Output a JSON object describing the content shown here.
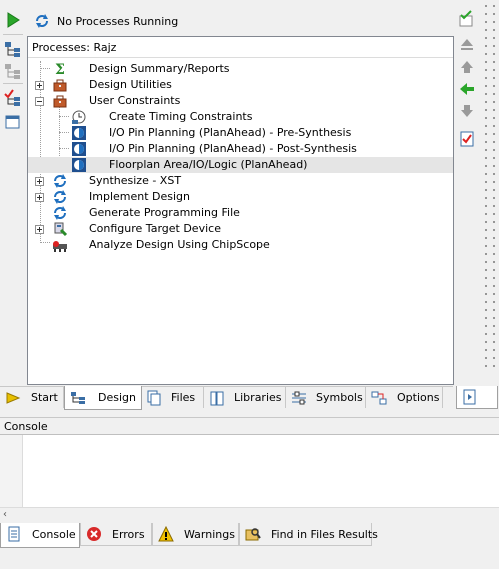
{
  "status": {
    "text": "No Processes Running"
  },
  "processes": {
    "title": "Processes:",
    "project": "Rajz",
    "items": [
      {
        "label": "Design Summary/Reports",
        "icon": "sigma-icon"
      },
      {
        "label": "Design Utilities",
        "icon": "toolbox-icon"
      },
      {
        "label": "User Constraints",
        "icon": "toolbox-icon"
      },
      {
        "label": "Create Timing Constraints",
        "icon": "clock-icon"
      },
      {
        "label": "I/O Pin Planning (PlanAhead) - Pre-Synthesis",
        "icon": "planahead-icon"
      },
      {
        "label": "I/O Pin Planning (PlanAhead) - Post-Synthesis",
        "icon": "planahead-icon"
      },
      {
        "label": "Floorplan Area/IO/Logic (PlanAhead)",
        "icon": "planahead-icon"
      },
      {
        "label": "Synthesize - XST",
        "icon": "process-cycle-icon"
      },
      {
        "label": "Implement Design",
        "icon": "process-cycle-icon"
      },
      {
        "label": "Generate Programming File",
        "icon": "process-cycle-icon"
      },
      {
        "label": "Configure Target Device",
        "icon": "device-icon"
      },
      {
        "label": "Analyze Design Using ChipScope",
        "icon": "chipscope-icon"
      }
    ]
  },
  "tabs": [
    {
      "label": "Start"
    },
    {
      "label": "Design"
    },
    {
      "label": "Files"
    },
    {
      "label": "Libraries"
    },
    {
      "label": "Symbols"
    },
    {
      "label": "Options"
    }
  ],
  "console": {
    "title": "Console"
  },
  "bottom_tabs": [
    {
      "label": "Console"
    },
    {
      "label": "Errors"
    },
    {
      "label": "Warnings"
    },
    {
      "label": "Find in Files Results"
    }
  ],
  "colors": {
    "accent": "#1f6fbf",
    "selected_row": "#e5e5e5",
    "panel_border": "#828790"
  }
}
